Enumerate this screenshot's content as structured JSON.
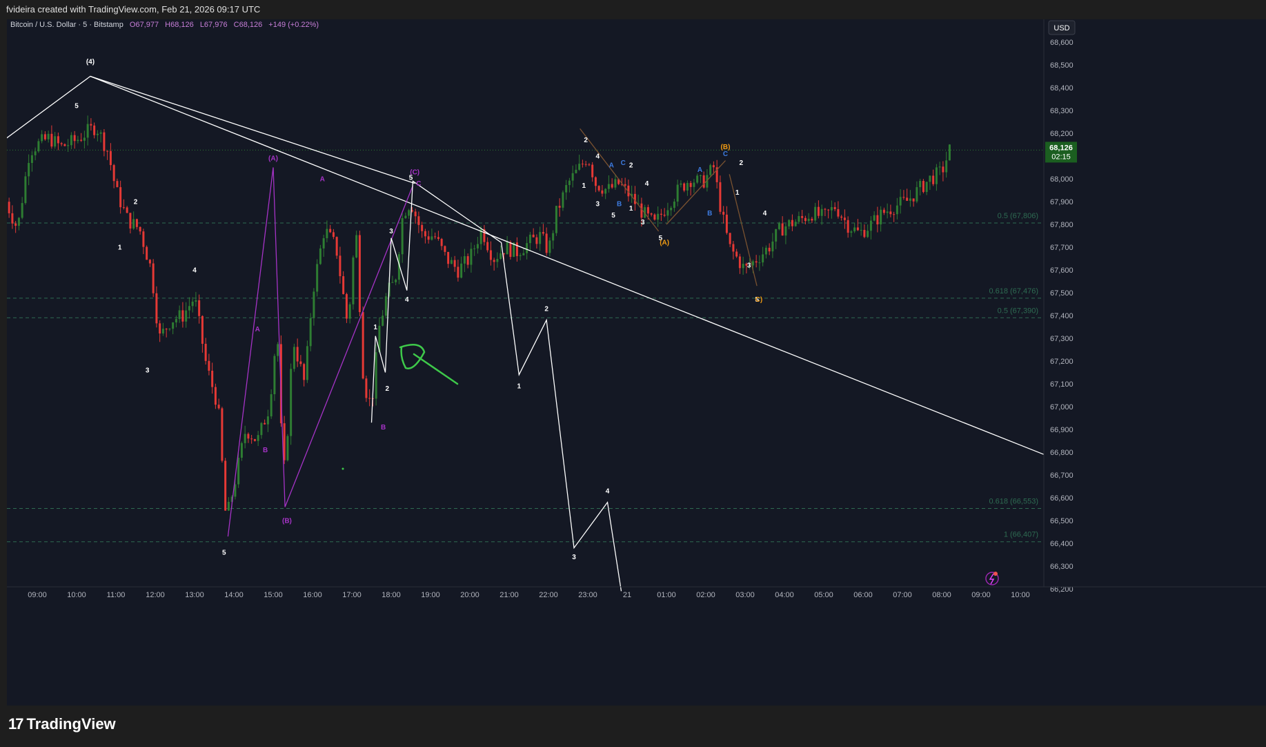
{
  "header": {
    "attribution": "fvideira created with TradingView.com, Feb 21, 2026 09:17 UTC"
  },
  "legend": {
    "symbol": "Bitcoin / U.S. Dollar · 5 · Bitstamp",
    "open": "O67,977",
    "high": "H68,126",
    "low": "L67,976",
    "close": "C68,126",
    "change": "+149 (+0.22%)"
  },
  "currency_button": "USD",
  "last_price": {
    "price": "68,126",
    "countdown": "02:15",
    "value": 68126
  },
  "brand": {
    "name": "TradingView"
  },
  "colors": {
    "bg": "#141824",
    "up": "#26a69a",
    "down": "#ef5350",
    "up_candle": "#2e7d32",
    "down_candle": "#e53935",
    "fib": "#2e6b52",
    "purple": "#a633c7",
    "orange": "#f39c12",
    "blue": "#3d7be0",
    "brown": "#7a5230"
  },
  "chart_data": {
    "type": "candlestick",
    "ylim": [
      66150,
      68650
    ],
    "x_ticks": [
      "09:00",
      "10:00",
      "11:00",
      "12:00",
      "13:00",
      "14:00",
      "15:00",
      "16:00",
      "17:00",
      "18:00",
      "19:00",
      "20:00",
      "21:00",
      "22:00",
      "23:00",
      "21",
      "01:00",
      "02:00",
      "03:00",
      "04:00",
      "05:00",
      "06:00",
      "07:00",
      "08:00",
      "09:00",
      "10:00"
    ],
    "y_ticks": [
      "68,600",
      "68,500",
      "68,400",
      "68,300",
      "68,200",
      "68,100",
      "68,000",
      "67,900",
      "67,800",
      "67,700",
      "67,600",
      "67,500",
      "67,400",
      "67,300",
      "67,200",
      "67,100",
      "67,000",
      "66,900",
      "66,800",
      "66,700",
      "66,600",
      "66,500",
      "66,400",
      "66,300",
      "66,200"
    ],
    "fib_levels": [
      {
        "label": "0.5 (67,806)",
        "value": 67806
      },
      {
        "label": "0.618 (67,476)",
        "value": 67476
      },
      {
        "label": "0.5 (67,390)",
        "value": 67390
      },
      {
        "label": "0.618 (66,553)",
        "value": 66553
      },
      {
        "label": "1 (66,407)",
        "value": 66407
      }
    ],
    "close_path": [
      [
        8.2,
        67900
      ],
      [
        8.5,
        67780
      ],
      [
        8.8,
        68120
      ],
      [
        9.0,
        68150
      ],
      [
        9.3,
        68180
      ],
      [
        9.6,
        68140
      ],
      [
        10.0,
        68170
      ],
      [
        10.3,
        68210
      ],
      [
        10.5,
        68230
      ],
      [
        10.8,
        68120
      ],
      [
        11.0,
        67950
      ],
      [
        11.3,
        67820
      ],
      [
        11.6,
        67780
      ],
      [
        11.9,
        67600
      ],
      [
        12.1,
        67300
      ],
      [
        12.4,
        67380
      ],
      [
        12.7,
        67400
      ],
      [
        13.0,
        67480
      ],
      [
        13.3,
        67180
      ],
      [
        13.6,
        67000
      ],
      [
        13.8,
        66500
      ],
      [
        14.0,
        66650
      ],
      [
        14.3,
        66900
      ],
      [
        14.6,
        66850
      ],
      [
        14.9,
        67000
      ],
      [
        15.1,
        67350
      ],
      [
        15.2,
        66900
      ],
      [
        15.3,
        66700
      ],
      [
        15.5,
        67300
      ],
      [
        15.8,
        67100
      ],
      [
        16.0,
        67500
      ],
      [
        16.3,
        67780
      ],
      [
        16.6,
        67700
      ],
      [
        16.9,
        67350
      ],
      [
        17.1,
        67800
      ],
      [
        17.3,
        67100
      ],
      [
        17.5,
        67000
      ],
      [
        17.7,
        67350
      ],
      [
        17.9,
        67500
      ],
      [
        18.1,
        67550
      ],
      [
        18.3,
        67850
      ],
      [
        18.5,
        67900
      ],
      [
        18.8,
        67750
      ],
      [
        19.1,
        67750
      ],
      [
        19.4,
        67650
      ],
      [
        19.7,
        67600
      ],
      [
        20.0,
        67650
      ],
      [
        20.3,
        67780
      ],
      [
        20.6,
        67650
      ],
      [
        20.9,
        67700
      ],
      [
        21.2,
        67680
      ],
      [
        21.5,
        67720
      ],
      [
        21.8,
        67750
      ],
      [
        22.0,
        67680
      ],
      [
        22.2,
        67850
      ],
      [
        22.5,
        67980
      ],
      [
        22.8,
        68050
      ],
      [
        23.0,
        68100
      ],
      [
        23.2,
        67980
      ],
      [
        23.5,
        67950
      ],
      [
        23.8,
        67980
      ],
      [
        24.1,
        67920
      ],
      [
        24.4,
        67850
      ],
      [
        24.7,
        67800
      ],
      [
        25.0,
        67880
      ],
      [
        25.3,
        67950
      ],
      [
        25.6,
        68000
      ],
      [
        25.9,
        67980
      ],
      [
        26.2,
        68050
      ],
      [
        26.4,
        67850
      ],
      [
        26.6,
        67700
      ],
      [
        26.8,
        67650
      ],
      [
        27.0,
        67600
      ],
      [
        27.3,
        67650
      ],
      [
        27.6,
        67700
      ],
      [
        27.9,
        67780
      ],
      [
        28.1,
        67800
      ],
      [
        28.4,
        67820
      ],
      [
        28.7,
        67850
      ],
      [
        29.0,
        67830
      ],
      [
        29.3,
        67880
      ],
      [
        29.6,
        67800
      ],
      [
        29.9,
        67760
      ],
      [
        30.2,
        67800
      ],
      [
        30.5,
        67850
      ],
      [
        30.8,
        67880
      ],
      [
        31.1,
        67900
      ],
      [
        31.4,
        67950
      ],
      [
        31.7,
        68000
      ],
      [
        32.0,
        68030
      ],
      [
        32.2,
        68126
      ]
    ],
    "wave_paths": [
      {
        "name": "white-main",
        "color": "#ffffff",
        "points": [
          [
            8.15,
            68170
          ],
          [
            10.35,
            68450
          ],
          [
            18.6,
            67980
          ]
        ]
      },
      {
        "name": "white-trendline",
        "color": "#ffffff",
        "points": [
          [
            10.35,
            68450
          ],
          [
            34.6,
            66790
          ]
        ]
      },
      {
        "name": "purple-abc",
        "color": "#a633c7",
        "points": [
          [
            13.85,
            66430
          ],
          [
            15.0,
            68050
          ],
          [
            15.3,
            66560
          ],
          [
            18.55,
            67970
          ]
        ]
      },
      {
        "name": "white-projection",
        "color": "#ffffff",
        "points": [
          [
            17.5,
            66930
          ],
          [
            17.6,
            67310
          ],
          [
            17.85,
            67150
          ],
          [
            18.0,
            67740
          ],
          [
            18.4,
            67510
          ],
          [
            18.55,
            67990
          ],
          [
            20.8,
            67720
          ],
          [
            21.25,
            67140
          ],
          [
            21.95,
            67380
          ],
          [
            22.65,
            66380
          ],
          [
            23.5,
            66580
          ],
          [
            23.85,
            66190
          ]
        ]
      },
      {
        "name": "brown-1",
        "color": "#7a5230",
        "points": [
          [
            22.8,
            68220
          ],
          [
            24.8,
            67770
          ]
        ]
      },
      {
        "name": "brown-2",
        "color": "#7a5230",
        "points": [
          [
            25.0,
            67800
          ],
          [
            26.5,
            68080
          ]
        ]
      },
      {
        "name": "brown-3",
        "color": "#7a5230",
        "points": [
          [
            26.6,
            68020
          ],
          [
            27.3,
            67530
          ]
        ]
      }
    ],
    "wave_labels": [
      {
        "t": "(4)",
        "x": 10.35,
        "y": 68505,
        "c": "#ffffff"
      },
      {
        "t": "5",
        "x": 10.0,
        "y": 68310,
        "c": "#ffffff"
      },
      {
        "t": "2",
        "x": 11.5,
        "y": 67890,
        "c": "#ffffff"
      },
      {
        "t": "1",
        "x": 11.1,
        "y": 67690,
        "c": "#ffffff"
      },
      {
        "t": "4",
        "x": 13.0,
        "y": 67590,
        "c": "#ffffff"
      },
      {
        "t": "3",
        "x": 11.8,
        "y": 67150,
        "c": "#ffffff"
      },
      {
        "t": "5",
        "x": 13.75,
        "y": 66350,
        "c": "#ffffff"
      },
      {
        "t": "(A)",
        "x": 15.0,
        "y": 68080,
        "c": "#a633c7"
      },
      {
        "t": "A",
        "x": 16.25,
        "y": 67990,
        "c": "#a633c7"
      },
      {
        "t": "A",
        "x": 14.6,
        "y": 67330,
        "c": "#a633c7"
      },
      {
        "t": "B",
        "x": 14.8,
        "y": 66800,
        "c": "#a633c7"
      },
      {
        "t": "(B)",
        "x": 15.35,
        "y": 66490,
        "c": "#a633c7"
      },
      {
        "t": "(C)",
        "x": 18.6,
        "y": 68020,
        "c": "#a633c7"
      },
      {
        "t": "C",
        "x": 18.7,
        "y": 67970,
        "c": "#a633c7"
      },
      {
        "t": "B",
        "x": 17.8,
        "y": 66900,
        "c": "#a633c7"
      },
      {
        "t": "5",
        "x": 18.5,
        "y": 67995,
        "c": "#ffffff"
      },
      {
        "t": "3",
        "x": 18.0,
        "y": 67760,
        "c": "#ffffff"
      },
      {
        "t": "4",
        "x": 18.4,
        "y": 67460,
        "c": "#ffffff"
      },
      {
        "t": "1",
        "x": 17.6,
        "y": 67340,
        "c": "#ffffff"
      },
      {
        "t": "2",
        "x": 17.9,
        "y": 67070,
        "c": "#ffffff"
      },
      {
        "t": "2",
        "x": 21.95,
        "y": 67420,
        "c": "#ffffff"
      },
      {
        "t": "1",
        "x": 21.25,
        "y": 67080,
        "c": "#ffffff"
      },
      {
        "t": "4",
        "x": 23.5,
        "y": 66620,
        "c": "#ffffff"
      },
      {
        "t": "3",
        "x": 22.65,
        "y": 66330,
        "c": "#ffffff"
      },
      {
        "t": "2",
        "x": 22.95,
        "y": 68160,
        "c": "#ffffff"
      },
      {
        "t": "4",
        "x": 23.25,
        "y": 68090,
        "c": "#ffffff"
      },
      {
        "t": "A",
        "x": 23.6,
        "y": 68050,
        "c": "#3d7be0"
      },
      {
        "t": "C",
        "x": 23.9,
        "y": 68060,
        "c": "#3d7be0"
      },
      {
        "t": "2",
        "x": 24.1,
        "y": 68050,
        "c": "#ffffff"
      },
      {
        "t": "1",
        "x": 22.9,
        "y": 67960,
        "c": "#ffffff"
      },
      {
        "t": "4",
        "x": 24.5,
        "y": 67970,
        "c": "#ffffff"
      },
      {
        "t": "3",
        "x": 23.25,
        "y": 67880,
        "c": "#ffffff"
      },
      {
        "t": "B",
        "x": 23.8,
        "y": 67880,
        "c": "#3d7be0"
      },
      {
        "t": "1",
        "x": 24.1,
        "y": 67860,
        "c": "#ffffff"
      },
      {
        "t": "5",
        "x": 23.65,
        "y": 67830,
        "c": "#ffffff"
      },
      {
        "t": "3",
        "x": 24.4,
        "y": 67800,
        "c": "#ffffff"
      },
      {
        "t": "5",
        "x": 24.85,
        "y": 67730,
        "c": "#ffffff"
      },
      {
        "t": "(A)",
        "x": 24.95,
        "y": 67710,
        "c": "#f39c12"
      },
      {
        "t": "A",
        "x": 25.85,
        "y": 68030,
        "c": "#3d7be0"
      },
      {
        "t": "B",
        "x": 26.1,
        "y": 67840,
        "c": "#3d7be0"
      },
      {
        "t": "(B)",
        "x": 26.5,
        "y": 68130,
        "c": "#f39c12"
      },
      {
        "t": "C",
        "x": 26.5,
        "y": 68100,
        "c": "#3d7be0"
      },
      {
        "t": "2",
        "x": 26.9,
        "y": 68060,
        "c": "#ffffff"
      },
      {
        "t": "1",
        "x": 26.8,
        "y": 67930,
        "c": "#ffffff"
      },
      {
        "t": "4",
        "x": 27.5,
        "y": 67840,
        "c": "#ffffff"
      },
      {
        "t": "3",
        "x": 27.1,
        "y": 67610,
        "c": "#ffffff"
      },
      {
        "t": "5",
        "x": 27.3,
        "y": 67460,
        "c": "#ffffff"
      },
      {
        "t": "C)",
        "x": 27.35,
        "y": 67460,
        "c": "#f39c12"
      }
    ]
  }
}
